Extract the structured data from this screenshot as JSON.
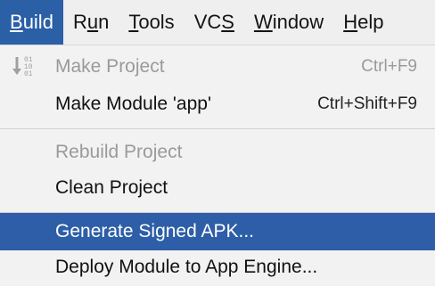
{
  "menubar": {
    "items": [
      {
        "label": "Build",
        "active": true
      },
      {
        "label": "Run"
      },
      {
        "label": "Tools"
      },
      {
        "label": "VCS"
      },
      {
        "label": "Window"
      },
      {
        "label": "Help"
      }
    ]
  },
  "build_menu": {
    "items": [
      {
        "label": "Make Project",
        "shortcut": "Ctrl+F9",
        "enabled": false,
        "icon": "make-binary-icon"
      },
      {
        "label": "Make Module 'app'",
        "shortcut": "Ctrl+Shift+F9",
        "enabled": true
      },
      {
        "label": "Rebuild Project",
        "enabled": false
      },
      {
        "label": "Clean Project",
        "enabled": true
      },
      {
        "label": "Generate Signed APK...",
        "enabled": true,
        "selected": true
      },
      {
        "label": "Deploy Module to App Engine...",
        "enabled": true
      }
    ]
  },
  "colors": {
    "selection": "#2d5ea7",
    "menubar_active": "#2b5fa6",
    "disabled_text": "#9a9a9a"
  }
}
